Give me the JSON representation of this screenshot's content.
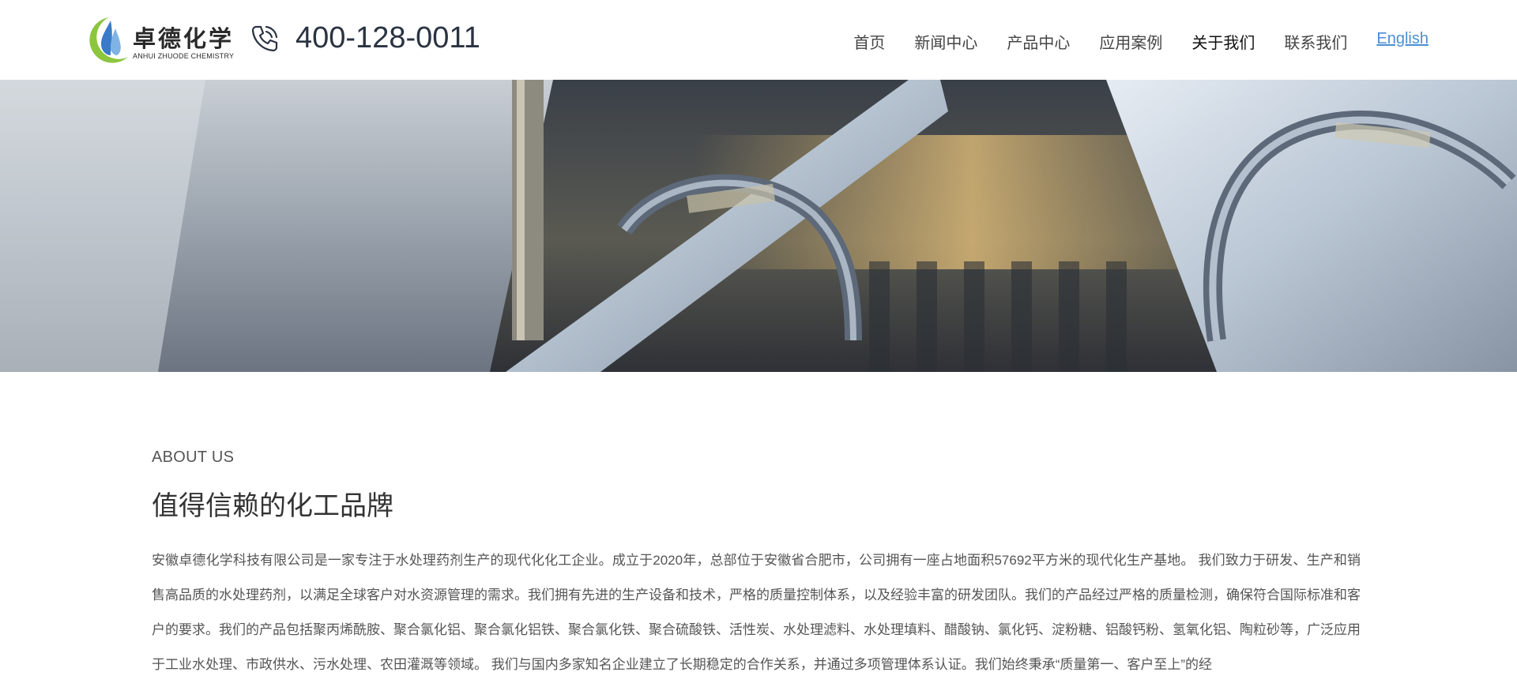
{
  "header": {
    "logo": {
      "name_cn": "卓德化学",
      "name_en": "ANHUI ZHUODE CHEMISTRY"
    },
    "phone_icon": "phone-icon",
    "phone": "400-128-0011",
    "nav": [
      {
        "label": "首页"
      },
      {
        "label": "新闻中心"
      },
      {
        "label": "产品中心"
      },
      {
        "label": "应用案例"
      },
      {
        "label": "关于我们"
      },
      {
        "label": "联系我们"
      },
      {
        "label": "English"
      }
    ]
  },
  "banner": {
    "description_icon": "industrial-pipes-image"
  },
  "about": {
    "eyebrow": "ABOUT US",
    "title": "值得信赖的化工品牌",
    "body": "安徽卓德化学科技有限公司是一家专注于水处理药剂生产的现代化化工企业。成立于2020年，总部位于安徽省合肥市，公司拥有一座占地面积57692平方米的现代化生产基地。 我们致力于研发、生产和销售高品质的水处理药剂，以满足全球客户对水资源管理的需求。我们拥有先进的生产设备和技术，严格的质量控制体系，以及经验丰富的研发团队。我们的产品经过严格的质量检测，确保符合国际标准和客户的要求。我们的产品包括聚丙烯酰胺、聚合氯化铝、聚合氯化铝铁、聚合氯化铁、聚合硫酸铁、活性炭、水处理滤料、水处理填料、醋酸钠、氯化钙、淀粉糖、铝酸钙粉、氢氧化铝、陶粒砂等，广泛应用于工业水处理、市政供水、污水处理、农田灌溉等领域。 我们与国内多家知名企业建立了长期稳定的合作关系，并通过多项管理体系认证。我们始终秉承“质量第一、客户至上”的经"
  },
  "colors": {
    "logo_green": "#8cc63f",
    "logo_blue": "#3a7bc8",
    "link_blue": "#4a8fd4",
    "phone_text": "#2a3342"
  }
}
